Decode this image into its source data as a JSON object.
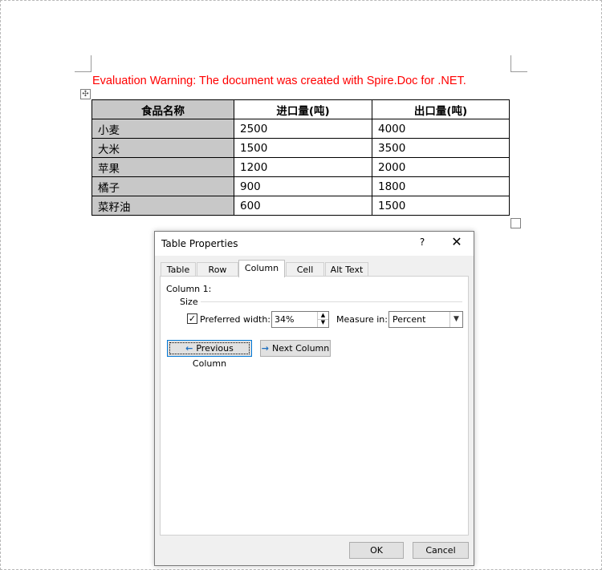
{
  "document": {
    "warning": "Evaluation Warning: The document was created with Spire.Doc for .NET.",
    "move_handle_icon": "move-cross-icon",
    "table": {
      "headers": [
        "食品名称",
        "进口量(吨)",
        "出口量(吨)"
      ],
      "rows": [
        [
          "小麦",
          "2500",
          "4000"
        ],
        [
          "大米",
          "1500",
          "3500"
        ],
        [
          "苹果",
          "1200",
          "2000"
        ],
        [
          "橘子",
          "900",
          "1800"
        ],
        [
          "菜籽油",
          "600",
          "1500"
        ]
      ],
      "shaded_color": "#c8c8c8"
    }
  },
  "dialog": {
    "title": "Table Properties",
    "help": "?",
    "close": "✕",
    "tabs": [
      "Table",
      "Row",
      "Column",
      "Cell",
      "Alt Text"
    ],
    "active_tab": "Column",
    "column_label": "Column 1:",
    "size_label": "Size",
    "preferred_width_checked": true,
    "preferred_width_label": "Preferred width:",
    "preferred_width_value": "34%",
    "measure_label": "Measure in:",
    "measure_value": "Percent",
    "prev_button": "Previous Column",
    "next_button": "Next Column",
    "ok": "OK",
    "cancel": "Cancel",
    "accent_color": "#0078d7"
  }
}
